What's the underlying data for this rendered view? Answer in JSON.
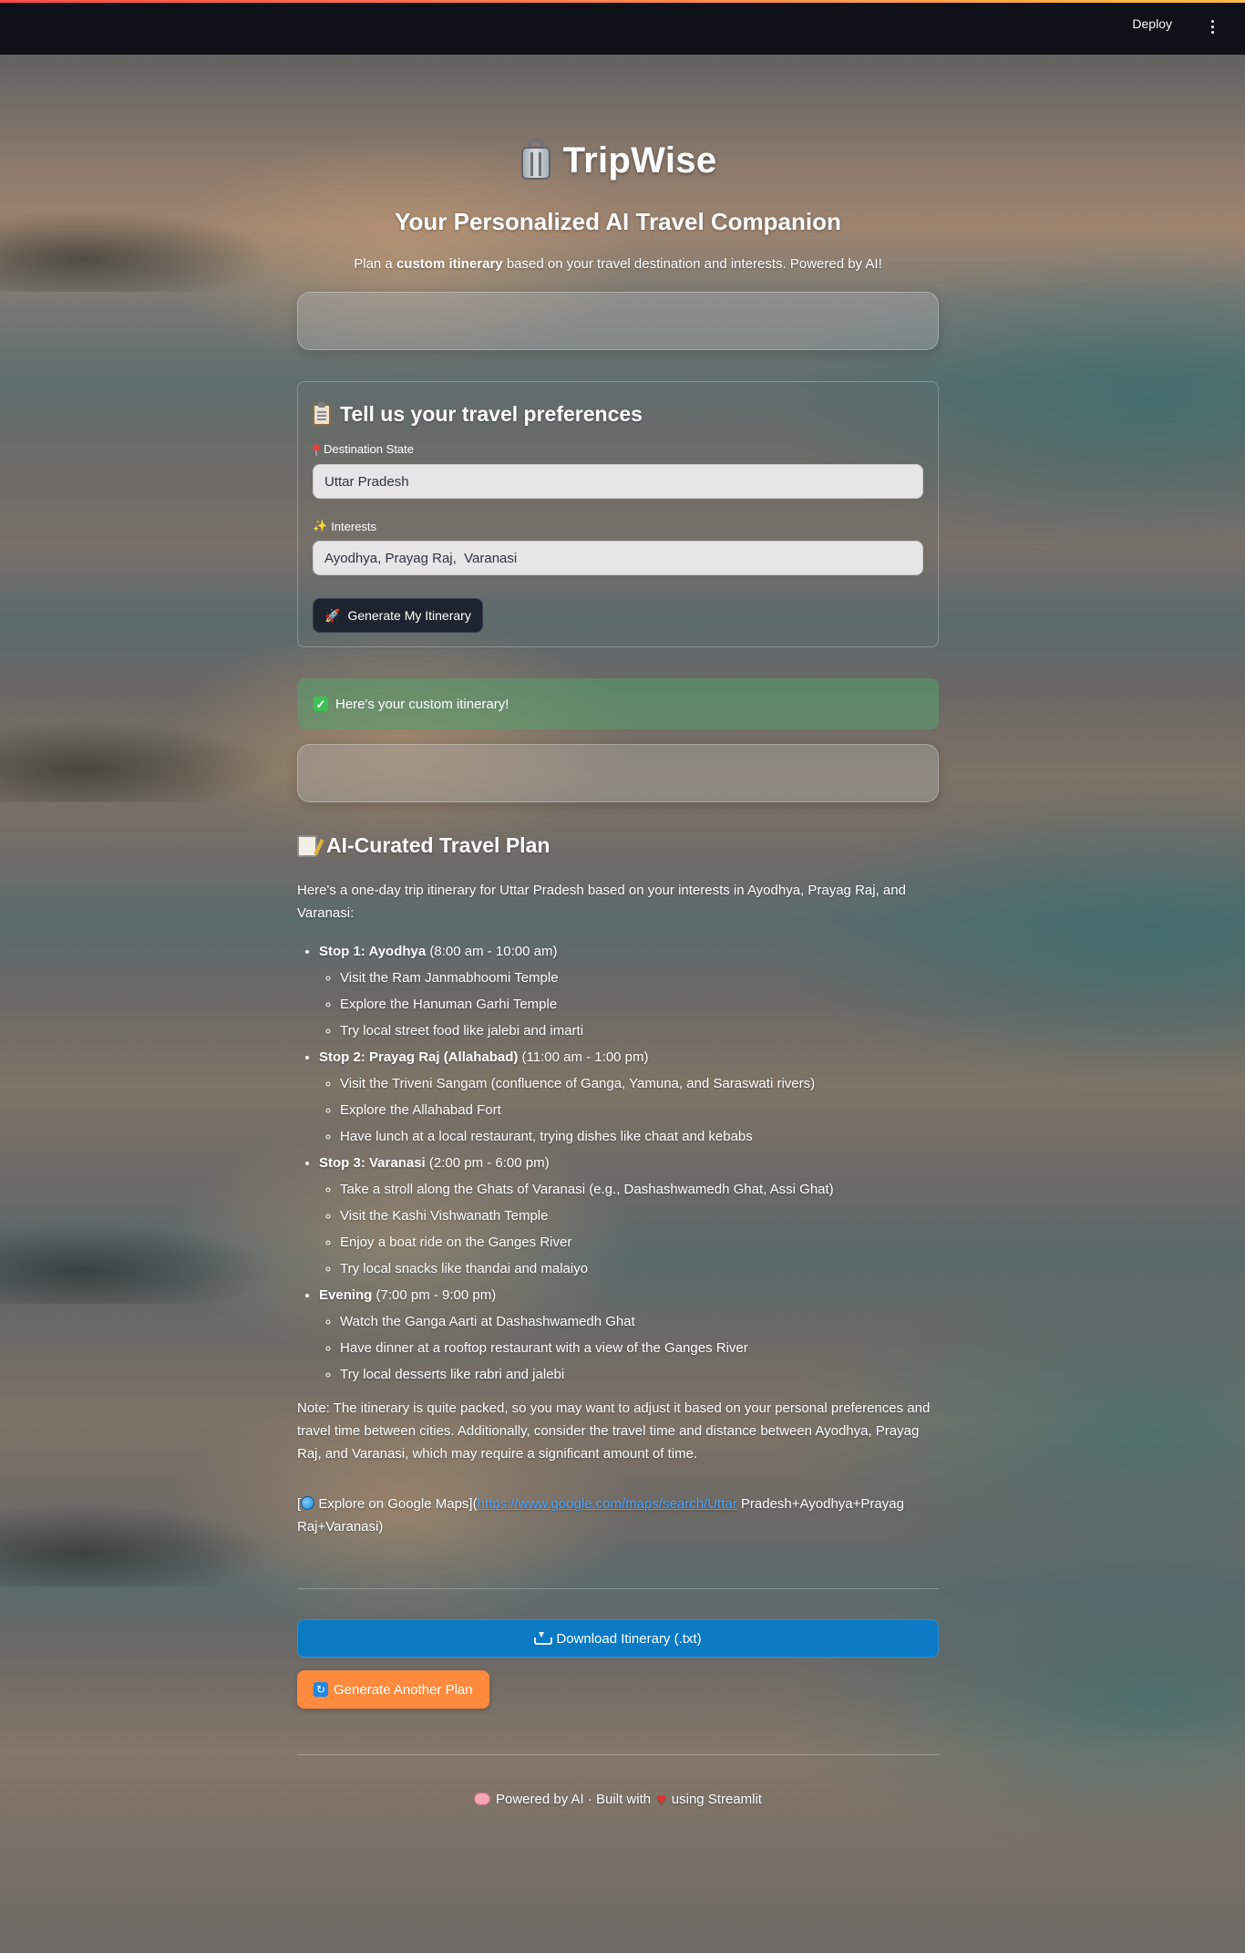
{
  "header": {
    "deploy_label": "Deploy"
  },
  "app": {
    "title": "TripWise",
    "subtitle": "Your Personalized AI Travel Companion",
    "tagline_before": "Plan a ",
    "tagline_bold": "custom itinerary",
    "tagline_after": " based on your travel destination and interests. Powered by AI!"
  },
  "form": {
    "title": "Tell us your travel preferences",
    "destination_label": "Destination State",
    "destination_value": "Uttar Pradesh",
    "interests_label": "Interests",
    "interests_value": "Ayodhya, Prayag Raj,  Varanasi",
    "generate_label": "Generate My Itinerary"
  },
  "success": {
    "text": "Here's your custom itinerary!"
  },
  "plan": {
    "title": "AI-Curated Travel Plan",
    "intro": "Here's a one-day trip itinerary for Uttar Pradesh based on your interests in Ayodhya, Prayag Raj, and Varanasi:",
    "stops": [
      {
        "name": "Stop 1: Ayodhya",
        "time": " (8:00 am - 10:00 am)",
        "items": [
          "Visit the Ram Janmabhoomi Temple",
          "Explore the Hanuman Garhi Temple",
          "Try local street food like jalebi and imarti"
        ]
      },
      {
        "name": "Stop 2: Prayag Raj (Allahabad)",
        "time": " (11:00 am - 1:00 pm)",
        "items": [
          "Visit the Triveni Sangam (confluence of Ganga, Yamuna, and Saraswati rivers)",
          "Explore the Allahabad Fort",
          "Have lunch at a local restaurant, trying dishes like chaat and kebabs"
        ]
      },
      {
        "name": "Stop 3: Varanasi",
        "time": " (2:00 pm - 6:00 pm)",
        "items": [
          "Take a stroll along the Ghats of Varanasi (e.g., Dashashwamedh Ghat, Assi Ghat)",
          "Visit the Kashi Vishwanath Temple",
          "Enjoy a boat ride on the Ganges River",
          "Try local snacks like thandai and malaiyo"
        ]
      },
      {
        "name": "Evening",
        "time": " (7:00 pm - 9:00 pm)",
        "items": [
          "Watch the Ganga Aarti at Dashashwamedh Ghat",
          "Have dinner at a rooftop restaurant with a view of the Ganges River",
          "Try local desserts like rabri and jalebi"
        ]
      }
    ],
    "note": "Note: The itinerary is quite packed, so you may want to adjust it based on your personal preferences and travel time between cities. Additionally, consider the travel time and distance between Ayodhya, Prayag Raj, and Varanasi, which may require a significant amount of time.",
    "maps_prefix": "[",
    "maps_label": " Explore on Google Maps](",
    "maps_link": "https://www.google.com/maps/search/Uttar",
    "maps_suffix": " Pradesh+Ayodhya+Prayag Raj+Varanasi)"
  },
  "actions": {
    "download_label": "Download Itinerary (.txt)",
    "again_label": "Generate Another Plan"
  },
  "footer": {
    "part1": "Powered by AI · Built with",
    "part2": "using Streamlit"
  }
}
